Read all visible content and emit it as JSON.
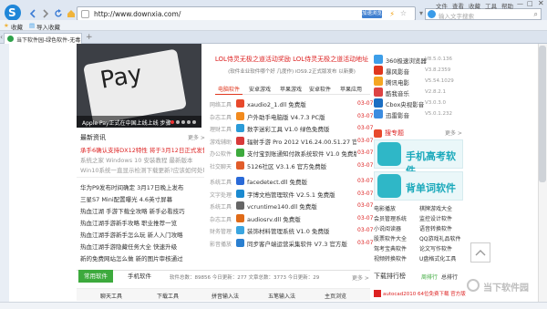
{
  "toolbar": {
    "url": "http://www.downxia.com/",
    "accel_label": "加速浏览",
    "search_placeholder": "输入文字搜索",
    "menu": [
      "文件",
      "查看",
      "收藏",
      "工具",
      "帮助"
    ]
  },
  "bookmarks": {
    "items": [
      "收藏",
      "导入收藏"
    ]
  },
  "tab": {
    "title": "当下软件园-绿色软件-无毒绿色软件..."
  },
  "hero": {
    "caption": "Apple Pay正式在中国上线上线 步骤"
  },
  "ad": {
    "line1": "LOL侍灵无极之道活动奖励 LOL侍灵无极之道活动地址",
    "line2": "(软件业业软件哪个好 几度作) iOS9.2正式版发布 以新要)"
  },
  "center_tabs": [
    "电脑软件",
    "安卓游戏",
    "苹果游戏",
    "安卓软件",
    "苹果应用"
  ],
  "left_section": {
    "title": "最新资讯",
    "more": "更多 >",
    "items": [
      {
        "title": "承手6确认支持DX12特性 将于3月12日正式发售",
        "red": true
      },
      {
        "title": "系统之家 Windows 10 安装教程 最新版本",
        "red": false
      },
      {
        "title": "Win10系统一直显示检测下载更新?应该如何处理 <<手4>>",
        "red": false
      },
      {
        "title": "华为P9发布时间确定 3月17日晚上发布",
        "red": false
      },
      {
        "title": "三星S7 Mini配置曝光 4.6英寸屏幕",
        "red": false
      },
      {
        "title": "热血江湖 手游下载全攻略 新手必看技巧",
        "red": false
      },
      {
        "title": "热血江湖手游新手攻略 职业推荐一览",
        "red": false
      },
      {
        "title": "热血江湖手游新手怎么玩 新人入门攻略",
        "red": false
      },
      {
        "title": "热血江湖手游隐藏任务大全 快速升级",
        "red": false
      },
      {
        "title": "新的免费网站怎么做 新的图片审核通过",
        "red": false
      }
    ]
  },
  "soft_list": {
    "items": [
      {
        "cat": "网络工具",
        "name": "xaudio2_1.dll 免费版",
        "date": "03-07"
      },
      {
        "cat": "杂志工具",
        "name": "户外助手电脑版 V4.7.3 PC版",
        "date": "03-07"
      },
      {
        "cat": "理财工具",
        "name": "数字迷彩工具 V1.0 绿色免费版",
        "date": "03-07"
      },
      {
        "cat": "游戏辅助",
        "name": "辐射手游 Pro 2012 V16.24.00.51.27 官方",
        "date": "03-07"
      },
      {
        "cat": "办公软件",
        "name": "支付宝到账通知付款系统软件 V1.0 免费版",
        "date": "03-07"
      },
      {
        "cat": "社交聊天",
        "name": "5126社区 V3.1.6 官方免费版",
        "date": "03-07"
      },
      {
        "cat": "系统工具",
        "name": "facedetect.dll 免费版",
        "date": "03-07"
      },
      {
        "cat": "文字处理",
        "name": "字博文档管理软件 V2.5.1 免费版",
        "date": "03-07"
      },
      {
        "cat": "系统工具",
        "name": "vcruntime140.dll 免费版",
        "date": "03-07"
      },
      {
        "cat": "杂志工具",
        "name": "audiosrv.dll 免费版",
        "date": "03-07"
      },
      {
        "cat": "财务管理",
        "name": "装饰材料管理系统 V1.0 免费版",
        "date": "03-07"
      },
      {
        "cat": "影音播放",
        "name": "同步客户端运营采集软件 V7.3 官方版",
        "date": "03-07"
      }
    ]
  },
  "rank": {
    "items": [
      {
        "name": "360极速浏览器",
        "ver": "V8.5.0.136",
        "color": "#3d9ee8"
      },
      {
        "name": "暴风影音",
        "ver": "V3.8.2359",
        "color": "#e0371e"
      },
      {
        "name": "腾讯电影",
        "ver": "V5.54.1029",
        "color": "#f5a623"
      },
      {
        "name": "酷我音乐",
        "ver": "V2.8.2.1",
        "color": "#d44"
      },
      {
        "name": "Cbox央视影音",
        "ver": "V3.0.3.0",
        "color": "#1b6ec2"
      },
      {
        "name": "迅雷影音",
        "ver": "V5.0.1.232",
        "color": "#3c8ce0"
      }
    ]
  },
  "search_section": {
    "title": "搜专题",
    "more": "更多 >"
  },
  "banners": [
    {
      "text": "手机高考软件"
    },
    {
      "text": "背单词软件"
    }
  ],
  "links": [
    [
      "电影播放",
      "棋牌游戏大全"
    ],
    [
      "会员管理系统",
      "监控设计软件"
    ],
    [
      "小说阅读器",
      "语音转换软件"
    ],
    [
      "股票软件大全",
      "QQ游戏礼品软件"
    ],
    [
      "驾考宝典软件",
      "论文写作软件"
    ],
    [
      "视频转换软件",
      "U盘格式化工具"
    ]
  ],
  "bottom": {
    "tab1": "常用软件",
    "tab2": "手机软件",
    "stats": "软件总数：89856  今日更新：277  文章总数：3773  今日更新：29",
    "more": "更多 >",
    "sub": [
      "聊天工具",
      "下载工具",
      "拼音输入法",
      "五笔输入法",
      "主页浏览"
    ],
    "right_title": "下载排行榜",
    "right_tabs": [
      "周排行",
      "总排行"
    ],
    "right_item": "autocad2010 64位免费下载 官方版"
  },
  "watermark": "当下软件园",
  "status": {
    "text": ""
  },
  "colors": {
    "accent": "#e0371e",
    "blue": "#3f7fd0"
  }
}
